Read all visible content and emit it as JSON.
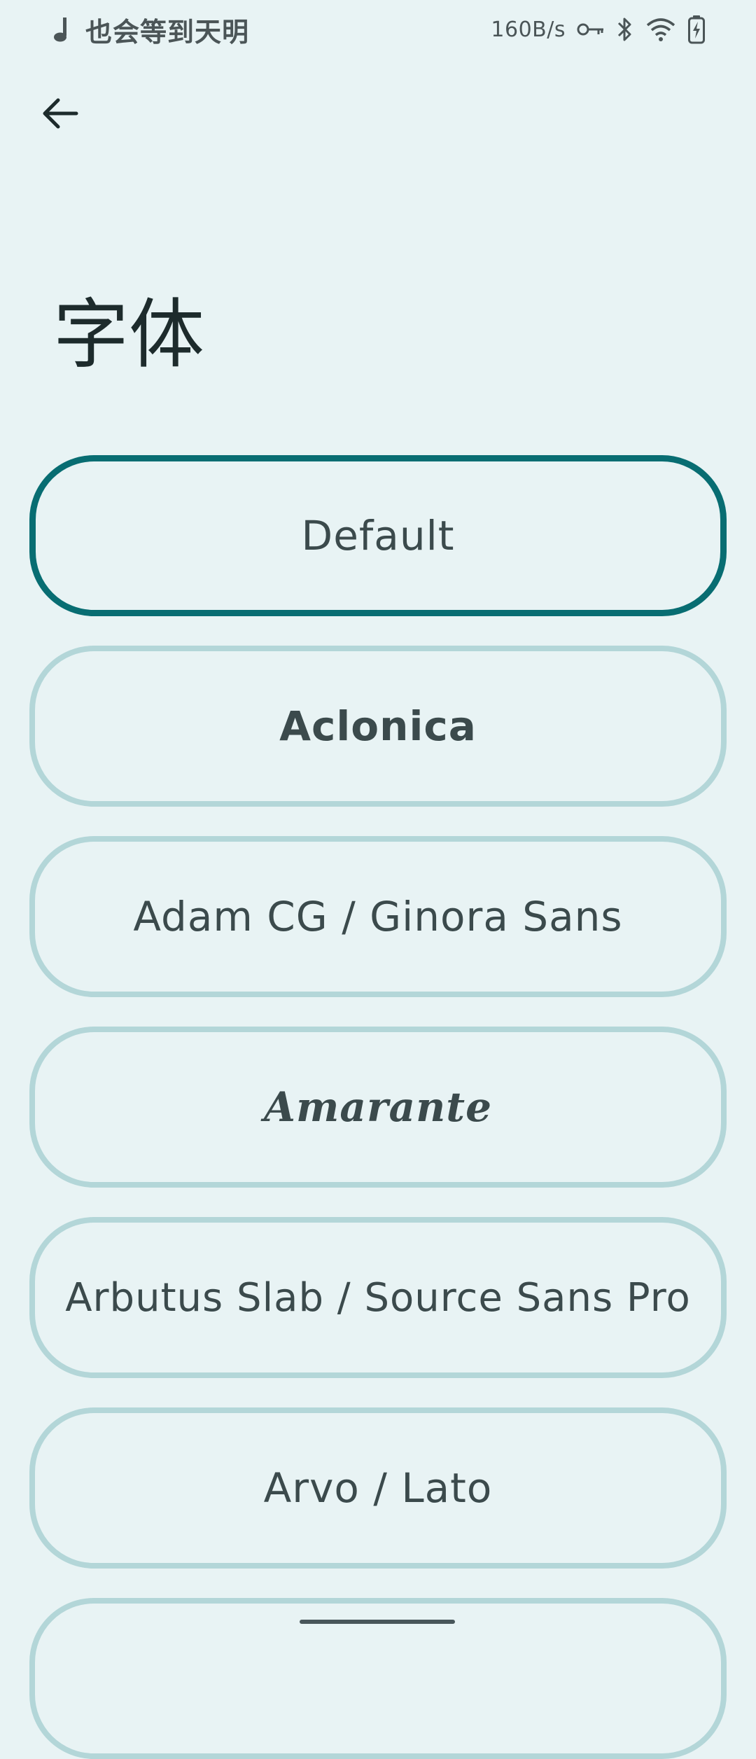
{
  "status_bar": {
    "now_playing_text": "也会等到天明",
    "network_speed": "160B/s",
    "icons": [
      "music-note-icon",
      "vpn-key-icon",
      "bluetooth-icon",
      "wifi-icon",
      "battery-charging-icon"
    ]
  },
  "header": {
    "back_icon": "arrow-left-icon",
    "title": "字体"
  },
  "font_options": [
    {
      "label": "Default",
      "selected": true
    },
    {
      "label": "Aclonica",
      "selected": false
    },
    {
      "label": "Adam CG / Ginora Sans",
      "selected": false
    },
    {
      "label": "Amarante",
      "selected": false
    },
    {
      "label": "Arbutus Slab / Source Sans Pro",
      "selected": false
    },
    {
      "label": "Arvo / Lato",
      "selected": false
    }
  ],
  "colors": {
    "background": "#e8f3f4",
    "selected_border": "#086d72",
    "unselected_border": "#b3d6d8",
    "text": "#3b4a4c"
  }
}
